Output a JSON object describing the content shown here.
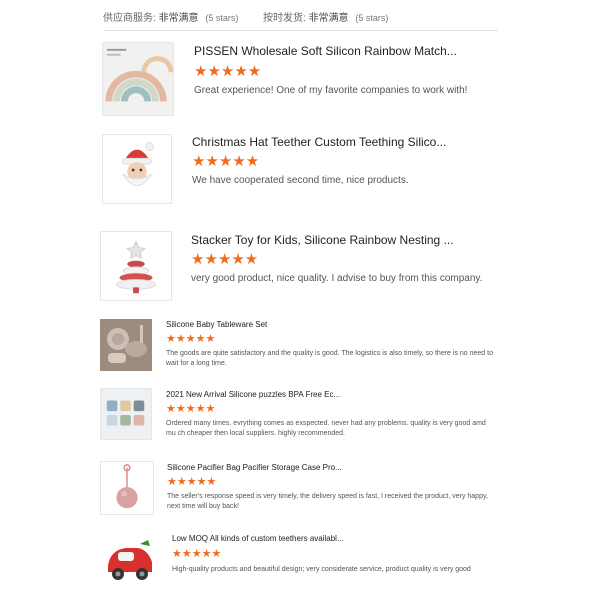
{
  "header": {
    "supplier_service": {
      "label": "供应商服务:",
      "value": "非常满意",
      "count": "(5 stars)"
    },
    "on_time_shipping": {
      "label": "按时发货:",
      "value": "非常满意",
      "count": "(5 stars)"
    }
  },
  "star_glyph": "★★★★★",
  "accent_color": "#f26b1d",
  "reviews": [
    {
      "title": "PISSEN Wholesale Soft Silicon Rainbow Match...",
      "rating": 5,
      "comment": "Great experience! One of my favorite companies to work with!",
      "thumbnail": "rainbow-stacker-photo"
    },
    {
      "title": "Christmas Hat Teether Custom Teething Silico...",
      "rating": 5,
      "comment": "We have cooperated  second time, nice products.",
      "thumbnail": "santa-teether-photo"
    },
    {
      "title": "Stacker Toy for Kids, Silicone Rainbow Nesting ...",
      "rating": 5,
      "comment": "very good product,  nice quality. I advise to buy from this company.",
      "thumbnail": "christmas-tree-stacker-photo"
    },
    {
      "title": "Silicone Baby Tableware Set",
      "rating": 5,
      "comment": "The goods are quite satisfactory and the quality is good. The logistics is also timely, so there is no need to wait for a long time.",
      "thumbnail": "tableware-set-photo"
    },
    {
      "title": "2021 New Arrival Silicone puzzles BPA Free Ec...",
      "rating": 5,
      "comment": "Ordered many times. evrything comes as exspected. never had any problems. quality is very good amd mu ch cheaper then local suppliers. highly recommended.",
      "thumbnail": "silicone-puzzle-photo"
    },
    {
      "title": "Silicone Pacifier Bag Pacifier Storage Case Pro...",
      "rating": 5,
      "comment": "The seller's response speed is very timely, the delivery speed is fast, I received the product, very happy, next time will buy back!",
      "thumbnail": "pacifier-case-photo"
    },
    {
      "title": "Low MOQ All kinds of custom teethers availabl...",
      "rating": 5,
      "comment": "High-quality products and beautiful design; very considerate service, product quality is very good",
      "thumbnail": "car-teether-photo"
    }
  ]
}
